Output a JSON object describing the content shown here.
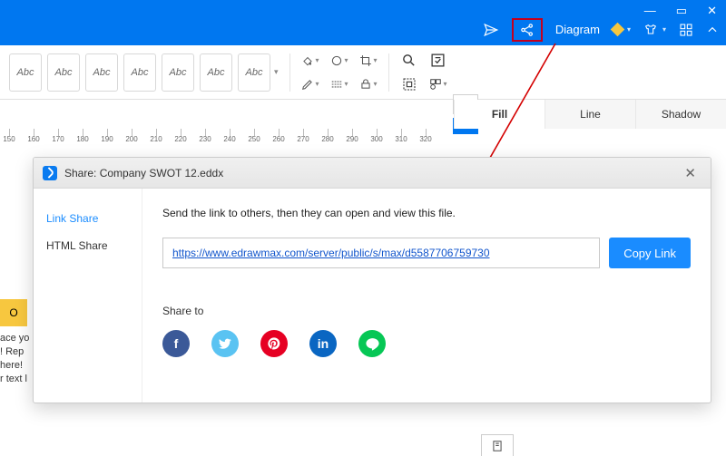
{
  "titlebar": {
    "diagram_label": "Diagram"
  },
  "ribbon": {
    "abc_label": "Abc"
  },
  "side_tabs": {
    "fill": "Fill",
    "line": "Line",
    "shadow": "Shadow"
  },
  "ruler": {
    "ticks": [
      150,
      160,
      170,
      180,
      190,
      200,
      210,
      220,
      230,
      240,
      250,
      260,
      270,
      280,
      290,
      300,
      310,
      320
    ]
  },
  "canvas": {
    "yellow_letter": "O",
    "stray1": "ace yo",
    "stray2": "!  Rep",
    "stray3": "here!",
    "stray4": "r text l"
  },
  "dialog": {
    "title": "Share: Company SWOT 12.eddx",
    "side": {
      "link_share": "Link Share",
      "html_share": "HTML Share"
    },
    "desc": "Send the link to others, then they can open and view this file.",
    "link": "https://www.edrawmax.com/server/public/s/max/d5587706759730",
    "copy": "Copy Link",
    "share_to": "Share to",
    "social": {
      "fb": "f",
      "tw": "",
      "pin": "",
      "li": "in",
      "line": ""
    }
  }
}
